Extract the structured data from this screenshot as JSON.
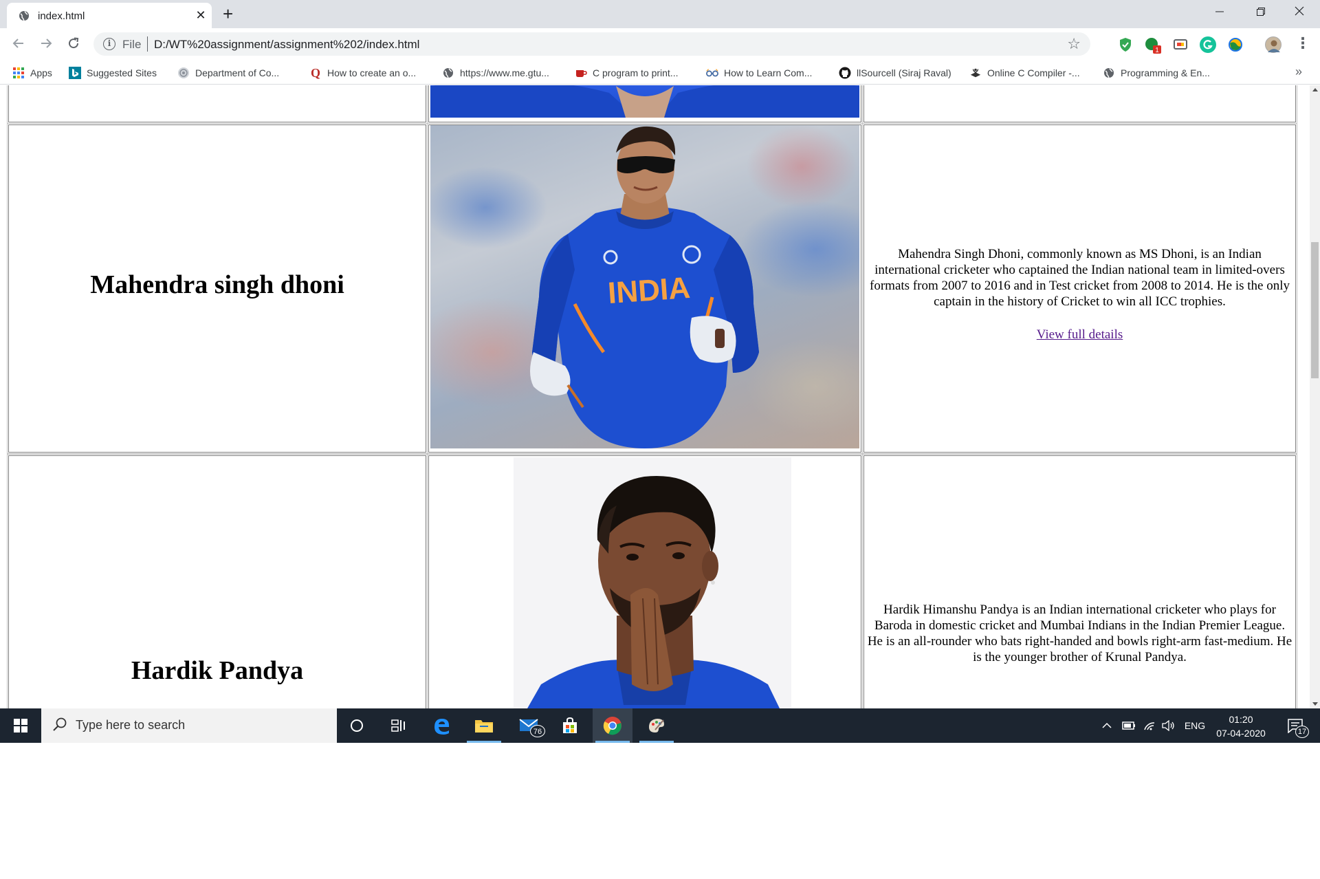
{
  "browser": {
    "tab_title": "index.html",
    "url_scheme": "File",
    "url": "D:/WT%20assignment/assignment%202/index.html",
    "window_controls": [
      "minimize",
      "restore",
      "close"
    ]
  },
  "bookmarks": [
    {
      "label": "Apps",
      "icon": "apps-grid-icon"
    },
    {
      "label": "Suggested Sites",
      "icon": "bing-icon"
    },
    {
      "label": "Department of Co...",
      "icon": "department-icon"
    },
    {
      "label": "How to create an o...",
      "icon": "quora-icon"
    },
    {
      "label": "https://www.me.gtu...",
      "icon": "globe-icon"
    },
    {
      "label": "C program to print...",
      "icon": "cup-icon"
    },
    {
      "label": "How to Learn Com...",
      "icon": "glasses-icon"
    },
    {
      "label": "llSourcell (Siraj Raval)",
      "icon": "github-icon"
    },
    {
      "label": "Online C Compiler -...",
      "icon": "compiler-icon"
    },
    {
      "label": "Programming & En...",
      "icon": "globe-icon"
    }
  ],
  "players": [
    {
      "name": "Mahendra singh dhoni",
      "photo": "ms-dhoni-photo",
      "jersey_text": "INDIA",
      "description": "Mahendra Singh Dhoni, commonly known as MS Dhoni, is an Indian international cricketer who captained the Indian national team in limited-overs formats from 2007 to 2016 and in Test cricket from 2008 to 2014. He is the only captain in the history of Cricket to win all ICC trophies.",
      "link_text": "View full details"
    },
    {
      "name": "Hardik Pandya",
      "photo": "hardik-pandya-photo",
      "description": "Hardik Himanshu Pandya is an Indian international cricketer who plays for Baroda in domestic cricket and Mumbai Indians in the Indian Premier League. He is an all-rounder who bats right-handed and bowls right-arm fast-medium. He is the younger brother of Krunal Pandya."
    }
  ],
  "taskbar": {
    "search_placeholder": "Type here to search",
    "mail_badge": "76",
    "language": "ENG",
    "time": "01:20",
    "date": "07-04-2020",
    "notification_count": "17"
  },
  "colors": {
    "visited_link": "#551a8b",
    "taskbar_bg": "#1c2530",
    "tabstrip_bg": "#dee1e6",
    "jersey_blue": "#1d4fd0"
  }
}
